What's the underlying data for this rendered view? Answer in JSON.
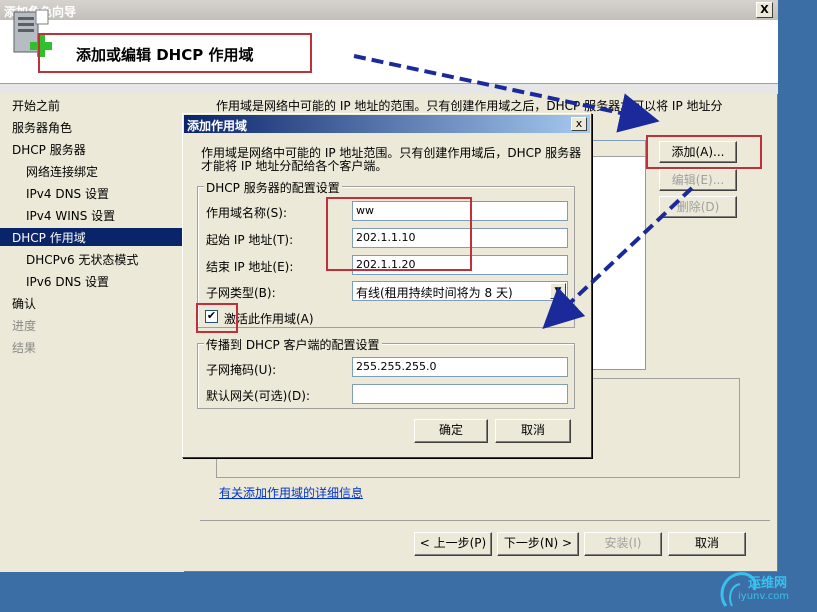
{
  "wizard": {
    "title": "添加角色向导",
    "close": "X",
    "header_title": "添加或编辑 DHCP 作用域",
    "header_icon": "server-add-icon"
  },
  "nav": {
    "items": [
      {
        "label": "开始之前",
        "state": "normal"
      },
      {
        "label": "服务器角色",
        "state": "normal"
      },
      {
        "label": "DHCP 服务器",
        "state": "normal"
      },
      {
        "label": "网络连接绑定",
        "state": "sub"
      },
      {
        "label": "IPv4 DNS 设置",
        "state": "sub"
      },
      {
        "label": "IPv4 WINS 设置",
        "state": "sub"
      },
      {
        "label": "DHCP 作用域",
        "state": "selected"
      },
      {
        "label": "DHCPv6 无状态模式",
        "state": "sub"
      },
      {
        "label": "IPv6 DNS 设置",
        "state": "sub"
      },
      {
        "label": "确认",
        "state": "normal"
      },
      {
        "label": "进度",
        "state": "disabled"
      },
      {
        "label": "结果",
        "state": "disabled"
      }
    ]
  },
  "main": {
    "description": "作用域是网络中可能的 IP 地址的范围。只有创建作用域之后，DHCP 服务器才可以将 IP 地址分",
    "add_button": "添加(A)...",
    "edit_button": "编辑(E)...",
    "delete_button": "删除(D)",
    "help_link": "有关添加作用域的详细信息"
  },
  "footer": {
    "prev": "< 上一步(P)",
    "next": "下一步(N) >",
    "install": "安装(I)",
    "cancel": "取消"
  },
  "dialog": {
    "title": "添加作用域",
    "close": "x",
    "description_line1": "作用域是网络中可能的 IP 地址范围。只有创建作用域后，DHCP 服务器",
    "description_line2": "才能将 IP 地址分配给各个客户端。",
    "group1_label": "DHCP 服务器的配置设置",
    "scope_name_label": "作用域名称(S):",
    "scope_name_value": "ww",
    "start_ip_label": "起始 IP 地址(T):",
    "start_ip_value": "202.1.1.10",
    "end_ip_label": "结束 IP 地址(E):",
    "end_ip_value": "202.1.1.20",
    "subnet_type_label": "子网类型(B):",
    "subnet_type_value": "有线(租用持续时间将为 8 天)",
    "activate_checkbox_label": "激活此作用域(A)",
    "activate_checked": "✔",
    "group2_label": "传播到 DHCP 客户端的配置设置",
    "subnet_mask_label": "子网掩码(U):",
    "subnet_mask_value": "255.255.255.0",
    "gateway_label": "默认网关(可选)(D):",
    "gateway_value": "",
    "ok_button": "确定",
    "cancel_button": "取消"
  },
  "watermark": {
    "text": "运维网",
    "url": "iyunv.com"
  },
  "colors": {
    "annotation_red": "#c0303a",
    "annotation_arrow": "#1a2a9a",
    "selection": "#0a246a"
  }
}
